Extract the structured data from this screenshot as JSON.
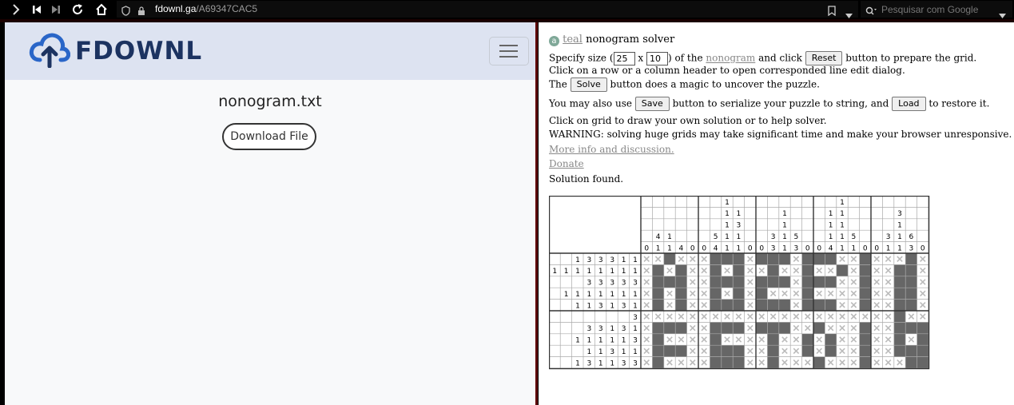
{
  "browser": {
    "url_host": "fdownl.ga",
    "url_path": "/A69347CAC5",
    "search_placeholder": "Pesquisar com Google"
  },
  "site": {
    "logo_text": "FDOWNL",
    "file_name": "nonogram.txt",
    "download_label": "Download File"
  },
  "solver": {
    "title_link": "teal",
    "title_rest": "nonogram solver",
    "line1_a": "Specify size (",
    "width_value": "25",
    "line1_x": "x",
    "height_value": "10",
    "line1_b": ") of the",
    "nonogram_link": "nonogram",
    "line1_c": "and click",
    "reset_label": "Reset",
    "line1_d": "button to prepare the grid.",
    "line2": "Click on a row or a column header to open corresponded line edit dialog.",
    "line3_a": "The",
    "solve_label": "Solve",
    "line3_b": "button does a magic to uncover the puzzle.",
    "line4_a": "You may also use",
    "save_label": "Save",
    "line4_b": "button to serialize your puzzle to string, and",
    "load_label": "Load",
    "line4_c": "to restore it.",
    "line5": "Click on grid to draw your own solution or to help solver.",
    "line6": "WARNING: solving huge grids may take significant time and make your browser unresponsive.",
    "more_info_link": "More info and discussion.",
    "donate_link": "Donate",
    "status": "Solution found."
  },
  "puzzle": {
    "cols": 25,
    "rows": 10,
    "col_clues": [
      [
        "0"
      ],
      [
        "4",
        "1"
      ],
      [
        "1",
        "1"
      ],
      [
        "4"
      ],
      [
        "0"
      ],
      [
        "0"
      ],
      [
        "5",
        "4"
      ],
      [
        "1",
        "1",
        "1",
        "1",
        "1"
      ],
      [
        "1",
        "3",
        "1",
        "1"
      ],
      [
        "0"
      ],
      [
        "0"
      ],
      [
        "3",
        "3"
      ],
      [
        "1",
        "1",
        "1",
        "1"
      ],
      [
        "5",
        "3"
      ],
      [
        "0"
      ],
      [
        "0"
      ],
      [
        "1",
        "1",
        "1",
        "4"
      ],
      [
        "1",
        "1",
        "1",
        "1",
        "1"
      ],
      [
        "5",
        "1"
      ],
      [
        "0"
      ],
      [
        "0"
      ],
      [
        "3",
        "1"
      ],
      [
        "3",
        "1",
        "1",
        "1"
      ],
      [
        "6",
        "3"
      ],
      [
        "0"
      ]
    ],
    "row_clues": [
      [
        "1",
        "3",
        "3",
        "3",
        "1",
        "1"
      ],
      [
        "1",
        "1",
        "1",
        "1",
        "1",
        "1",
        "1",
        "1",
        "1"
      ],
      [
        "3",
        "3",
        "3",
        "3",
        "3"
      ],
      [
        "1",
        "1",
        "1",
        "1",
        "1",
        "1",
        "1"
      ],
      [
        "1",
        "1",
        "3",
        "1",
        "3",
        "1"
      ],
      [
        "3"
      ],
      [
        "3",
        "3",
        "1",
        "3",
        "1"
      ],
      [
        "1",
        "1",
        "1",
        "1",
        "1",
        "3"
      ],
      [
        "1",
        "1",
        "3",
        "1",
        "1"
      ],
      [
        "1",
        "3",
        "1",
        "1",
        "3",
        "3"
      ]
    ],
    "cells": [
      "xxFxxxFFFxFFFxFFFxxFxxxFx",
      "xFxFxxFxFxxFxxFxxFxFxxFFx",
      "xFFFxxFFFxFFFxFFFxxFxxFFx",
      "xFxFxxFxFxFxxxFxxxxFxxFFx",
      "xFxFxxFFFxFFFxFFFxxFxxFFx",
      "xxxxxxxxxxxxxxxxxxxxxxFxx",
      "xFFFxxFFFxFFFxxFxxxFxxFFF",
      "xFxxxxFxxxxFxxFxFxxFxxFxF",
      "xFFFxxFFFxxFxxFxFxxFxxFFF",
      "xFxxxxFFFxxFxxxFxxxFxxxFF"
    ],
    "colors": {
      "filled": "#666666",
      "empty": "#ffffff",
      "cross": "#bbbbbb",
      "line": "#aaaaaa",
      "block": "#333333"
    }
  }
}
